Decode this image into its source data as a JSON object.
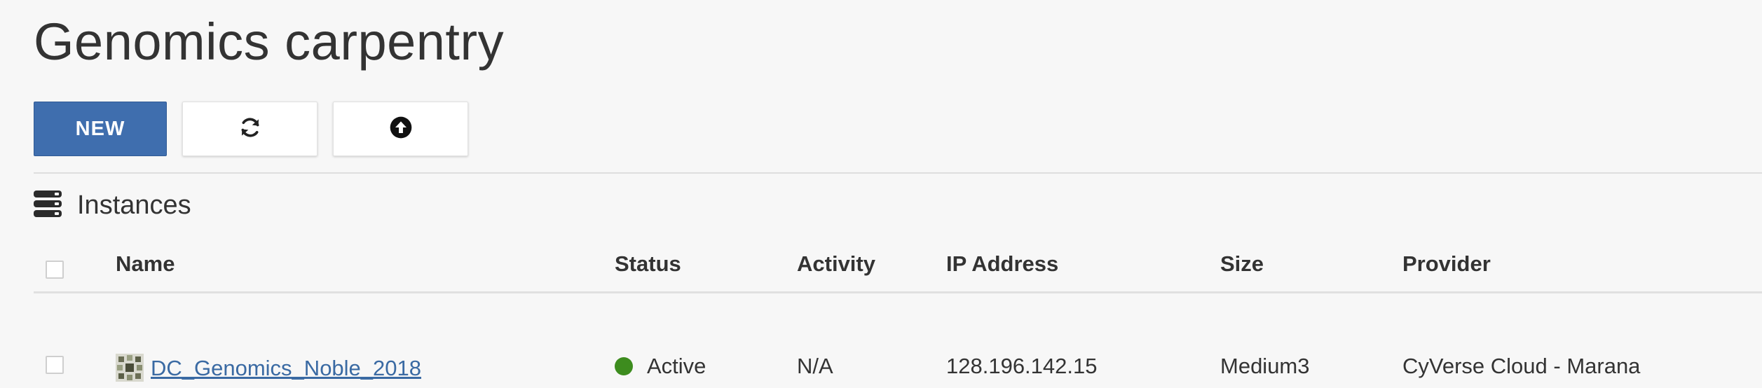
{
  "page": {
    "title": "Genomics carpentry"
  },
  "toolbar": {
    "new_label": "NEW",
    "refresh_icon": "refresh-icon",
    "upload_icon": "upload-icon",
    "primary_color": "#3f6eae"
  },
  "instances": {
    "title": "Instances",
    "icon": "server-stack-icon",
    "columns": {
      "name": "Name",
      "status": "Status",
      "activity": "Activity",
      "ip": "IP Address",
      "size": "Size",
      "provider": "Provider"
    },
    "rows": [
      {
        "name": "DC_Genomics_Noble_2018",
        "status": "Active",
        "status_color": "#3d8c1e",
        "activity": "N/A",
        "ip": "128.196.142.15",
        "size": "Medium3",
        "provider": "CyVerse Cloud - Marana"
      }
    ]
  }
}
